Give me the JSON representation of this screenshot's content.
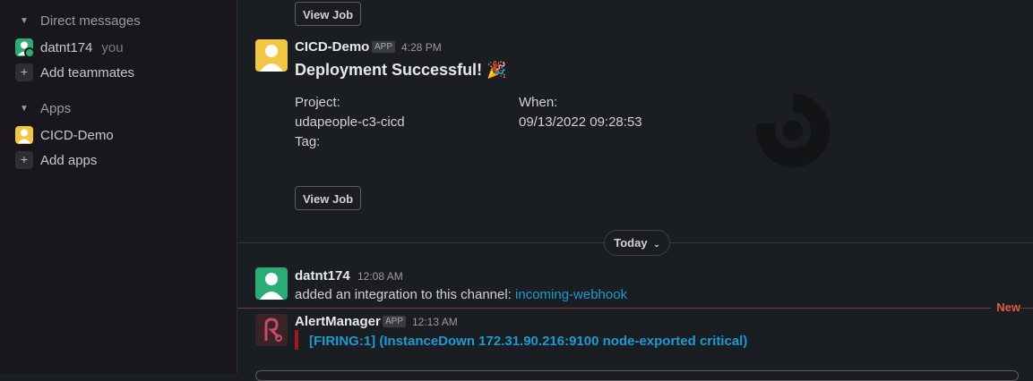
{
  "sidebar": {
    "dm_section": "Direct messages",
    "dm_user": "datnt174",
    "dm_you": "you",
    "add_teammates": "Add teammates",
    "apps_section": "Apps",
    "app_item": "CICD-Demo",
    "add_apps": "Add apps"
  },
  "messages": {
    "top_view_job": "View Job",
    "cicd": {
      "name": "CICD-Demo",
      "badge": "APP",
      "time": "4:28 PM",
      "title": "Deployment Successful! 🎉",
      "project_label": "Project:",
      "project_value": "udapeople-c3-cicd",
      "when_label": "When:",
      "when_value": "09/13/2022 09:28:53",
      "tag_label": "Tag:",
      "view_job": "View Job"
    },
    "day_divider": "Today",
    "day_divider_icon": "chevron-down-icon",
    "integration": {
      "name": "datnt174",
      "time": "12:08 AM",
      "text": "added an integration to this channel: ",
      "link": "incoming-webhook"
    },
    "new_label": "New",
    "alert": {
      "name": "AlertManager",
      "badge": "APP",
      "time": "12:13 AM",
      "text": "[FIRING:1]  (InstanceDown 172.31.90.216:9100 node-exported critical)"
    }
  },
  "colors": {
    "accent_link": "#1d9bd1",
    "new_marker": "#e55a43",
    "alert_bar": "#a3171a"
  }
}
